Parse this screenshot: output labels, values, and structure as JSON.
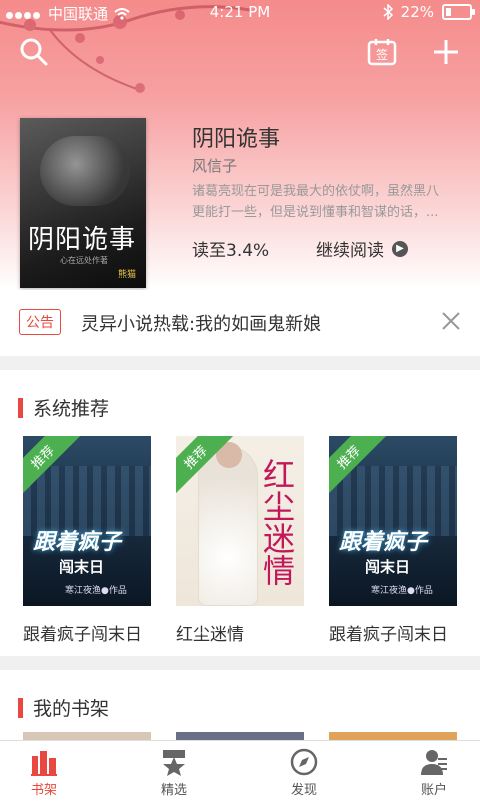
{
  "status_bar": {
    "carrier": "中国联通",
    "time": "4:21 PM",
    "battery": "22%"
  },
  "current_book": {
    "title": "阴阳诡事",
    "author": "风信子",
    "description": "诸葛亮现在可是我最大的依仗啊，虽然黑八更能打一些，但是说到懂事和智谋的话，...",
    "progress": "读至3.4%",
    "continue_label": "继续阅读",
    "cover_title": "阴阳诡事",
    "cover_sub": "心在远处作著",
    "cover_logo": "熊猫"
  },
  "notice": {
    "badge": "公告",
    "text": "灵异小说热载:我的如画鬼新娘"
  },
  "recommend": {
    "title": "系统推荐",
    "tag": "推荐",
    "books": [
      {
        "name": "跟着疯子闯末日",
        "cover_title": "跟着疯子",
        "cover_title2": "闯末日",
        "cover_author": "寒江夜渔●作品"
      },
      {
        "name": "红尘迷情",
        "cover_title": "红尘迷情"
      },
      {
        "name": "跟着疯子闯末日",
        "cover_title": "跟着疯子",
        "cover_title2": "闯末日",
        "cover_author": "寒江夜渔●作品"
      }
    ]
  },
  "shelf": {
    "title": "我的书架"
  },
  "tabs": [
    {
      "label": "书架",
      "active": true
    },
    {
      "label": "精选",
      "active": false
    },
    {
      "label": "发现",
      "active": false
    },
    {
      "label": "账户",
      "active": false
    }
  ],
  "colors": {
    "accent": "#e8483f",
    "header": "#f58b8b"
  }
}
